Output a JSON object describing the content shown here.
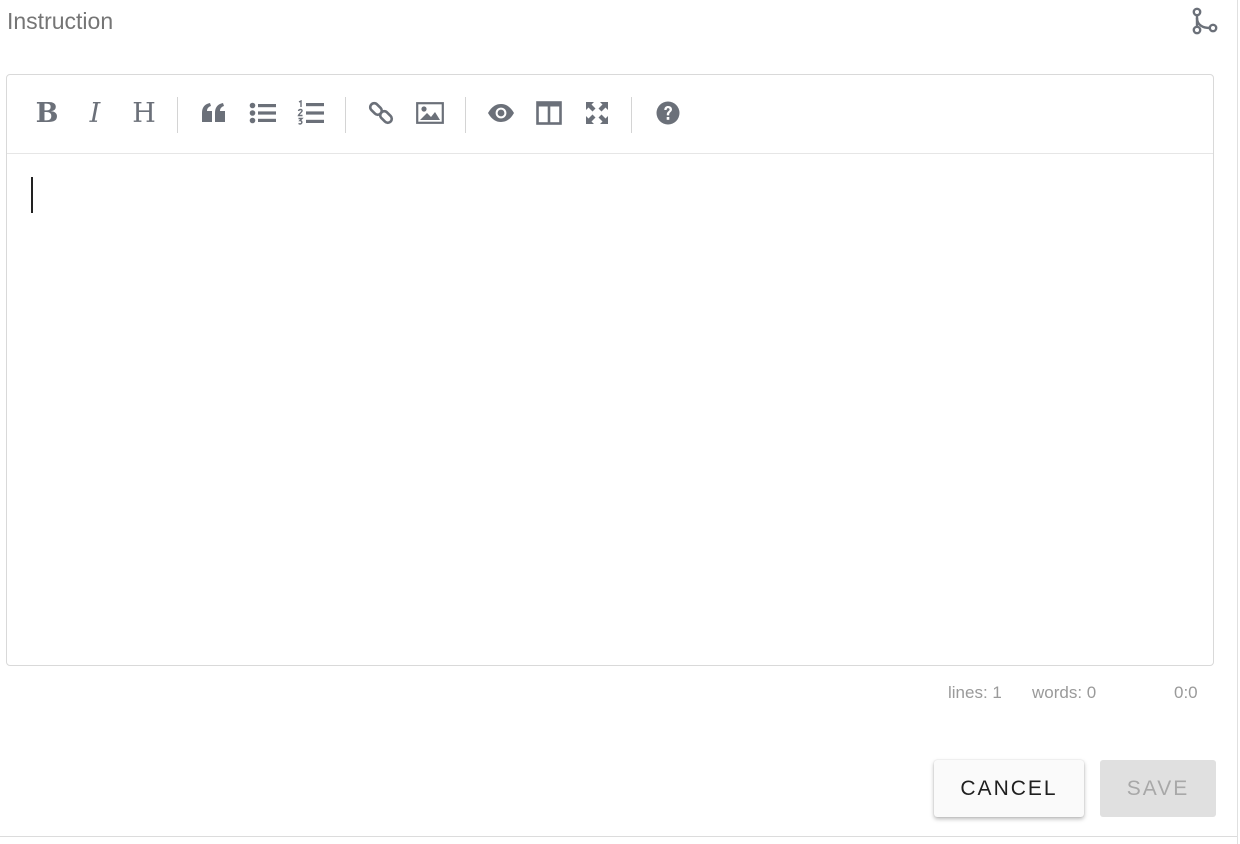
{
  "header": {
    "title": "Instruction",
    "branch_icon": "git-branch-icon"
  },
  "toolbar": {
    "bold_label": "B",
    "italic_label": "I",
    "heading_label": "H",
    "icons": [
      "bold-icon",
      "italic-icon",
      "heading-icon",
      "quote-icon",
      "unordered-list-icon",
      "ordered-list-icon",
      "link-icon",
      "image-icon",
      "preview-icon",
      "side-by-side-icon",
      "fullscreen-icon",
      "help-icon"
    ]
  },
  "editor": {
    "content": ""
  },
  "status": {
    "lines": "lines: 1",
    "words": "words: 0",
    "cursor": "0:0"
  },
  "actions": {
    "cancel_label": "CANCEL",
    "save_label": "SAVE"
  },
  "colors": {
    "icon": "#6b7079",
    "save_disabled_bg": "#e0e0e0",
    "save_disabled_text": "#a8a8a8"
  }
}
